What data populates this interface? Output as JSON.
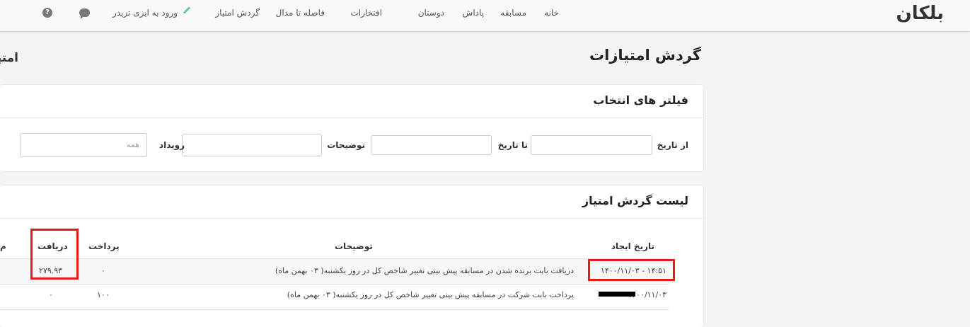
{
  "navbar": {
    "brand": "بلکان",
    "items": [
      "خانه",
      "مسابقه",
      "پاداش",
      "دوستان",
      "افتخارات",
      "فاصله تا مدال",
      "گردش امتیاز",
      "ورود به ایزی تریدر"
    ],
    "help_icon_glyph": "?"
  },
  "page": {
    "title": "گردش امتیازات",
    "side_title": "امتیاز"
  },
  "filters": {
    "title": "فیلتر های انتخاب",
    "from_date_label": "از تاریخ",
    "to_date_label": "تا تاریخ",
    "description_label": "توضیحات",
    "event_label": "رویداد",
    "event_value": "همه"
  },
  "list": {
    "title": "لیست گردش امتیاز",
    "headers": {
      "created": "تاریخ ایجاد",
      "description": "توضیحات",
      "payment": "پرداخت",
      "received": "دریافت",
      "partial": "م"
    },
    "rows": [
      {
        "created": "۱۴۰۰/۱۱/۰۳ - ۱۴:۵۱",
        "description": "دریافت بابت برنده شدن در مسابقه پیش بینی تغییر شاخص کل در روز یکشنبه( ۰۳ بهمن ماه)",
        "payment": "۰",
        "received": "۲۷۹.۹۳"
      },
      {
        "created": "۱۴۰۰/۱۱/۰۳",
        "description": "پرداخت بابت شرکت در مسابقه پیش بینی تغییر شاخص کل در روز یکشنبه( ۰۳ بهمن ماه)",
        "payment": "۱۰۰",
        "received": "۰"
      }
    ]
  },
  "colors": {
    "highlight": "#e21b1b",
    "accent": "#6cc4a4"
  }
}
